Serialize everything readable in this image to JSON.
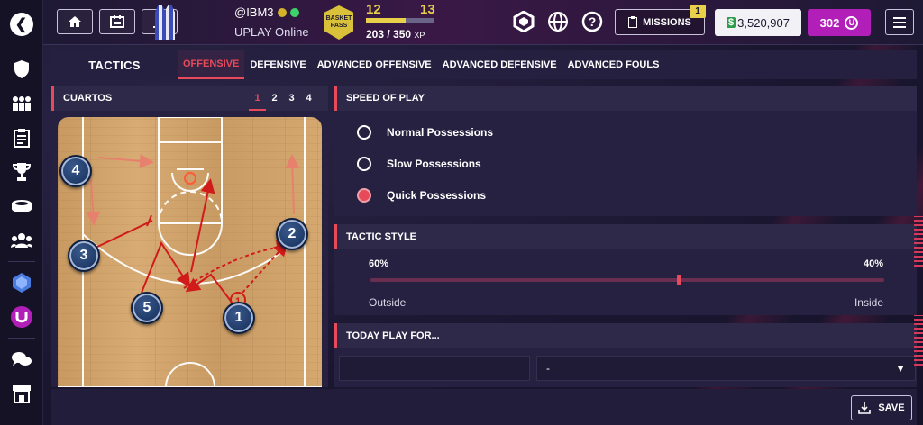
{
  "header": {
    "username": "@IBM3",
    "status": "UPLAY Online",
    "pass_label": "BASKET PASS",
    "level_current": "12",
    "level_next": "13",
    "xp_current": "203 / 350",
    "xp_unit": "XP",
    "xp_progress": 0.58,
    "missions_label": "MISSIONS",
    "missions_count": "1",
    "money": "3,520,907",
    "coins": "302"
  },
  "tabs": {
    "title": "TACTICS",
    "items": [
      "OFFENSIVE",
      "DEFENSIVE",
      "ADVANCED OFFENSIVE",
      "ADVANCED DEFENSIVE",
      "ADVANCED FOULS"
    ],
    "active": "OFFENSIVE"
  },
  "court": {
    "title": "CUARTOS",
    "quarters": [
      "1",
      "2",
      "3",
      "4"
    ],
    "active_quarter": "1",
    "players": [
      "4",
      "3",
      "5",
      "2",
      "1"
    ]
  },
  "speed": {
    "title": "SPEED OF PLAY",
    "options": [
      "Normal Possessions",
      "Slow Possessions",
      "Quick Possessions"
    ],
    "selected": "Quick Possessions"
  },
  "style": {
    "title": "TACTIC STYLE",
    "outside_value": "60%",
    "inside_value": "40%",
    "outside_label": "Outside",
    "inside_label": "Inside",
    "outside_fraction": 0.6
  },
  "today": {
    "title": "TODAY PLAY FOR...",
    "select_value": "-"
  },
  "footer": {
    "save_label": "SAVE"
  },
  "colors": {
    "accent": "#e84a5a",
    "coins": "#b21fb8",
    "xp": "#e8d04a"
  }
}
